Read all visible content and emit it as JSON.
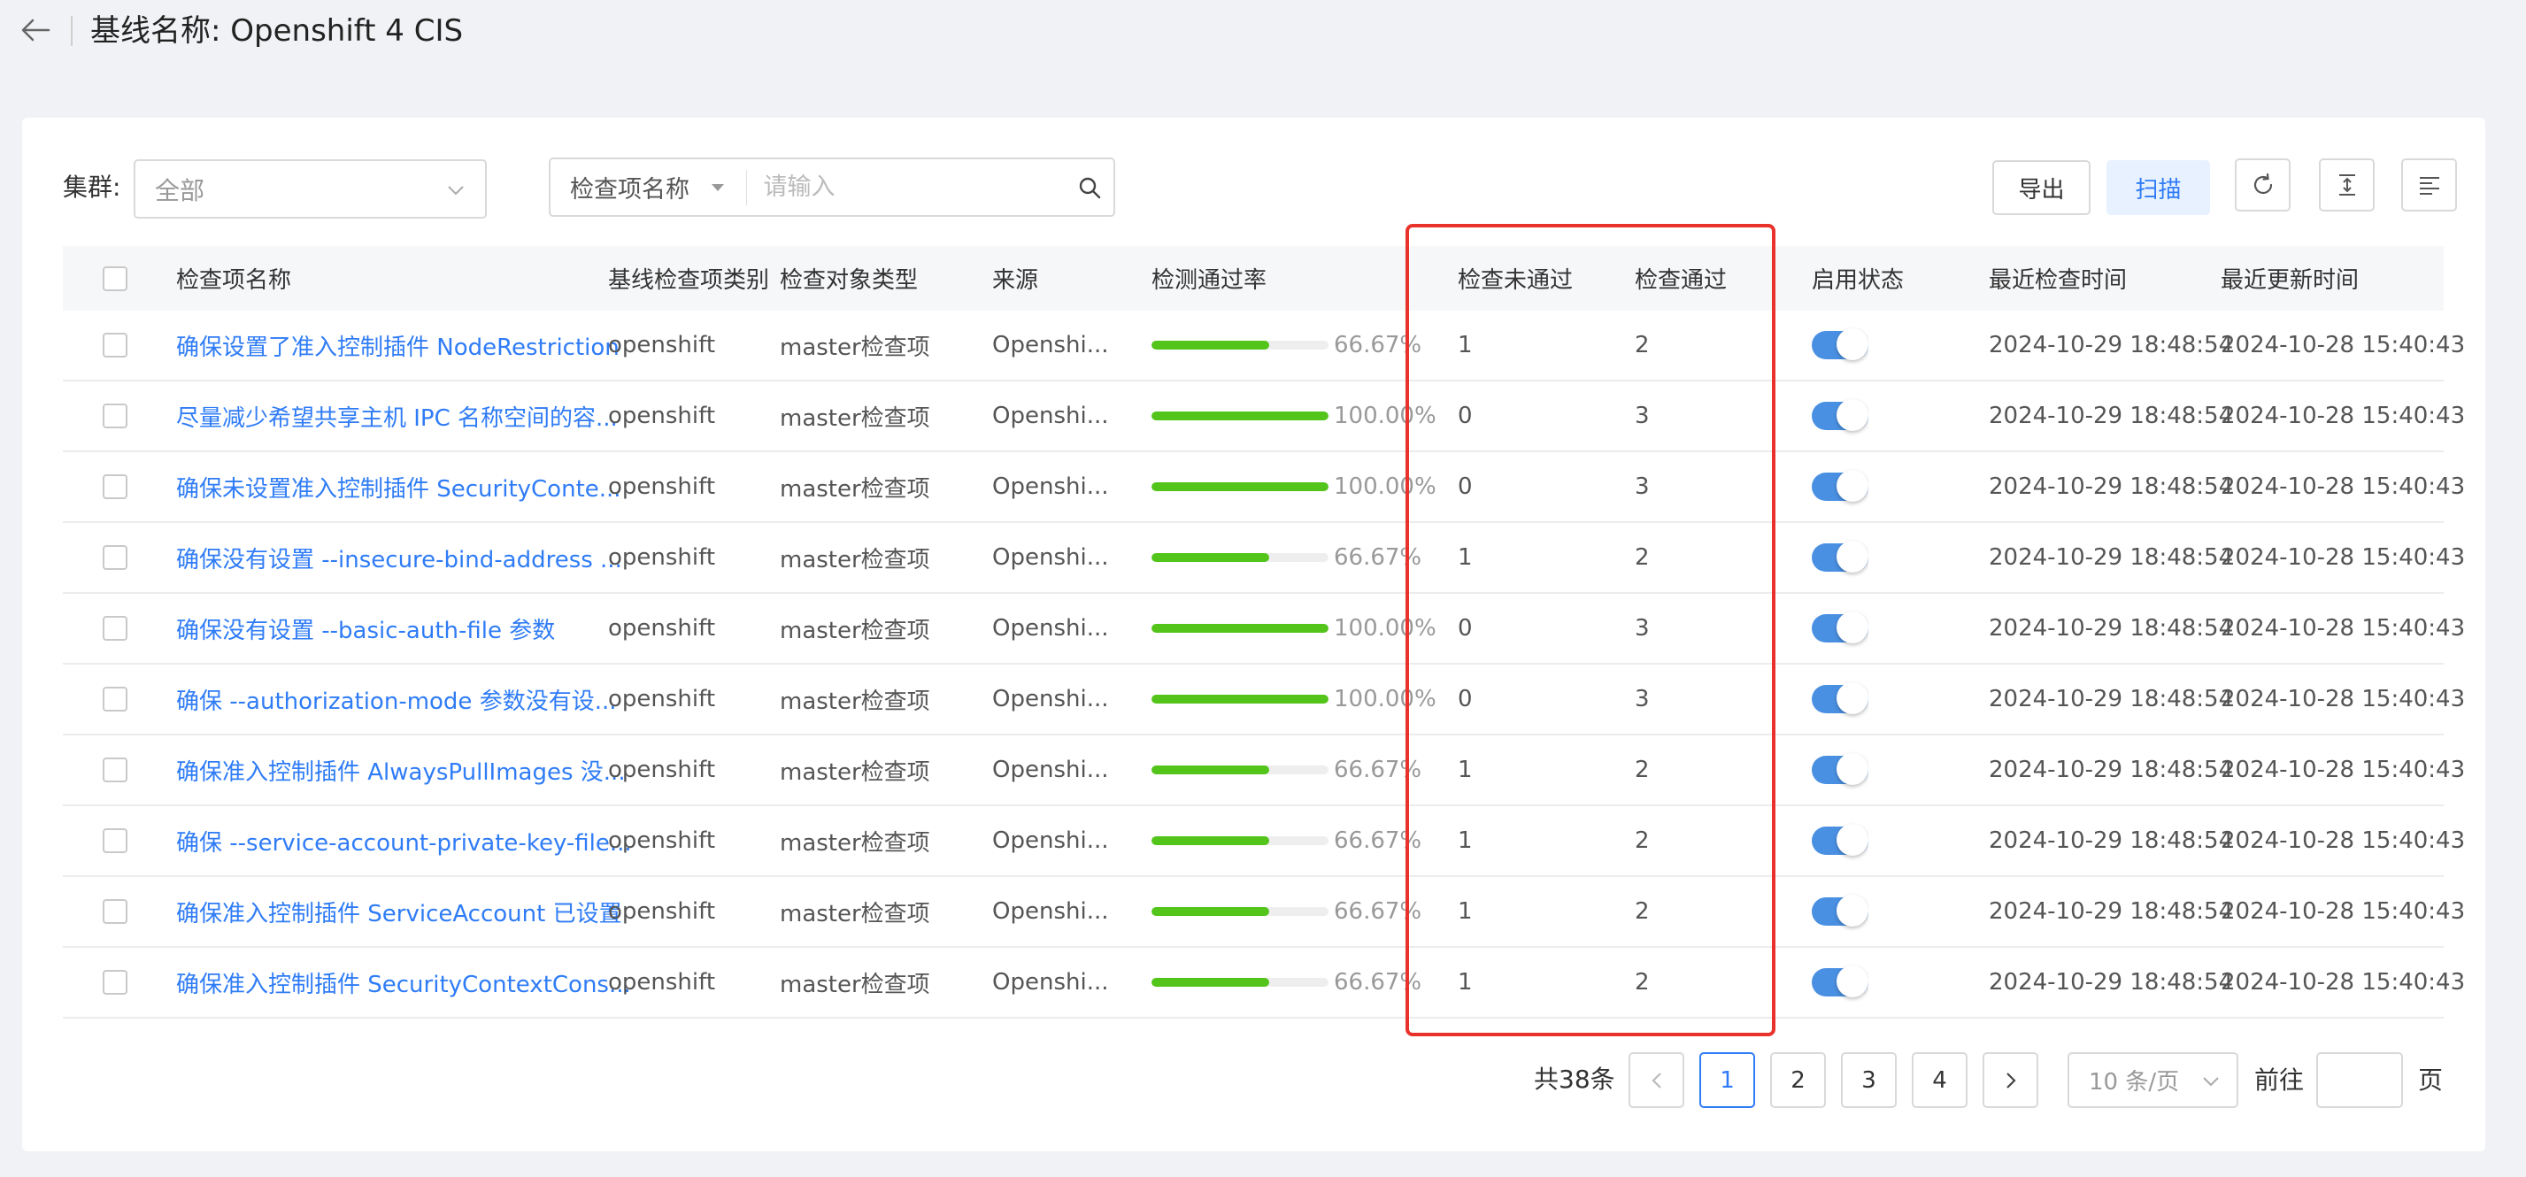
{
  "header": {
    "title": "基线名称: Openshift 4 CIS",
    "back_icon": "arrow-left-icon"
  },
  "filters": {
    "cluster_label": "集群:",
    "cluster_value": "全部",
    "search_field": "检查项名称",
    "search_placeholder": "请输入"
  },
  "toolbar": {
    "export_label": "导出",
    "scan_label": "扫描",
    "icons": [
      "refresh-icon",
      "density-icon",
      "column-settings-icon"
    ]
  },
  "table": {
    "columns": [
      "检查项名称",
      "基线检查项类别",
      "检查对象类型",
      "来源",
      "检测通过率",
      "检查未通过",
      "检查通过",
      "启用状态",
      "最近检查时间",
      "最近更新时间"
    ],
    "rows": [
      {
        "name": "确保设置了准入控制插件 NodeRestriction",
        "category": "openshift",
        "object_type": "master检查项",
        "source": "Openshi...",
        "pass_rate": 66.67,
        "pass_rate_label": "66.67%",
        "failed": "1",
        "passed": "2",
        "enabled": true,
        "last_check": "2024-10-29 18:48:54",
        "last_update": "2024-10-28 15:40:43"
      },
      {
        "name": "尽量减少希望共享主机 IPC 名称空间的容...",
        "category": "openshift",
        "object_type": "master检查项",
        "source": "Openshi...",
        "pass_rate": 100,
        "pass_rate_label": "100.00%",
        "failed": "0",
        "passed": "3",
        "enabled": true,
        "last_check": "2024-10-29 18:48:54",
        "last_update": "2024-10-28 15:40:43"
      },
      {
        "name": "确保未设置准入控制插件 SecurityConte...",
        "category": "openshift",
        "object_type": "master检查项",
        "source": "Openshi...",
        "pass_rate": 100,
        "pass_rate_label": "100.00%",
        "failed": "0",
        "passed": "3",
        "enabled": true,
        "last_check": "2024-10-29 18:48:54",
        "last_update": "2024-10-28 15:40:43"
      },
      {
        "name": "确保没有设置 --insecure-bind-address ...",
        "category": "openshift",
        "object_type": "master检查项",
        "source": "Openshi...",
        "pass_rate": 66.67,
        "pass_rate_label": "66.67%",
        "failed": "1",
        "passed": "2",
        "enabled": true,
        "last_check": "2024-10-29 18:48:54",
        "last_update": "2024-10-28 15:40:43"
      },
      {
        "name": "确保没有设置 --basic-auth-file 参数",
        "category": "openshift",
        "object_type": "master检查项",
        "source": "Openshi...",
        "pass_rate": 100,
        "pass_rate_label": "100.00%",
        "failed": "0",
        "passed": "3",
        "enabled": true,
        "last_check": "2024-10-29 18:48:54",
        "last_update": "2024-10-28 15:40:43"
      },
      {
        "name": "确保 --authorization-mode 参数没有设...",
        "category": "openshift",
        "object_type": "master检查项",
        "source": "Openshi...",
        "pass_rate": 100,
        "pass_rate_label": "100.00%",
        "failed": "0",
        "passed": "3",
        "enabled": true,
        "last_check": "2024-10-29 18:48:54",
        "last_update": "2024-10-28 15:40:43"
      },
      {
        "name": "确保准入控制插件 AlwaysPullImages 没...",
        "category": "openshift",
        "object_type": "master检查项",
        "source": "Openshi...",
        "pass_rate": 66.67,
        "pass_rate_label": "66.67%",
        "failed": "1",
        "passed": "2",
        "enabled": true,
        "last_check": "2024-10-29 18:48:54",
        "last_update": "2024-10-28 15:40:43"
      },
      {
        "name": "确保 --service-account-private-key-file...",
        "category": "openshift",
        "object_type": "master检查项",
        "source": "Openshi...",
        "pass_rate": 66.67,
        "pass_rate_label": "66.67%",
        "failed": "1",
        "passed": "2",
        "enabled": true,
        "last_check": "2024-10-29 18:48:54",
        "last_update": "2024-10-28 15:40:43"
      },
      {
        "name": "确保准入控制插件 ServiceAccount 已设置",
        "category": "openshift",
        "object_type": "master检查项",
        "source": "Openshi...",
        "pass_rate": 66.67,
        "pass_rate_label": "66.67%",
        "failed": "1",
        "passed": "2",
        "enabled": true,
        "last_check": "2024-10-29 18:48:54",
        "last_update": "2024-10-28 15:40:43"
      },
      {
        "name": "确保准入控制插件 SecurityContextCons...",
        "category": "openshift",
        "object_type": "master检查项",
        "source": "Openshi...",
        "pass_rate": 66.67,
        "pass_rate_label": "66.67%",
        "failed": "1",
        "passed": "2",
        "enabled": true,
        "last_check": "2024-10-29 18:48:54",
        "last_update": "2024-10-28 15:40:43"
      }
    ]
  },
  "pagination": {
    "total_label": "共38条",
    "pages": [
      "1",
      "2",
      "3",
      "4"
    ],
    "current_page": "1",
    "page_size": "10 条/页",
    "goto_label": "前往",
    "page_unit": "页"
  },
  "colors": {
    "accent": "#2f7cf6",
    "progress": "#52c41a",
    "highlight_box": "#e8322b",
    "toggle_on": "#4a90e2"
  }
}
